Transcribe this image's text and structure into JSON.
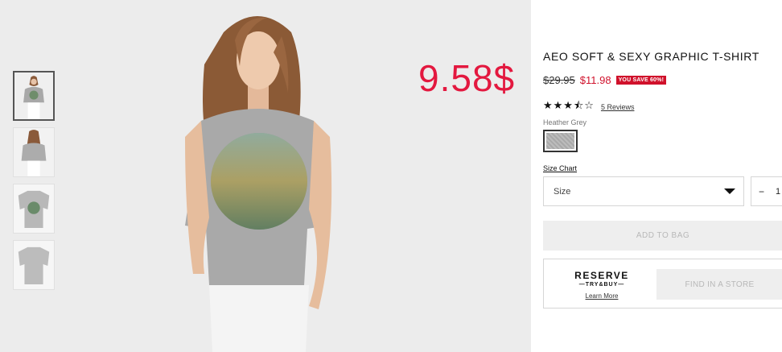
{
  "overlay_price": "9.58$",
  "product": {
    "title": "AEO SOFT & SEXY GRAPHIC T-SHIRT",
    "old_price": "$29.95",
    "sale_price": "$11.98",
    "save_badge": "YOU SAVE 60%!",
    "stars_display": "★★★⯪☆",
    "rating": 3.5,
    "rating_max": 5,
    "reviews_link": "5 Reviews",
    "color_name": "Heather Grey",
    "size_chart_link": "Size Chart",
    "size_select_label": "Size",
    "qty_minus": "−",
    "qty_value": "1",
    "add_to_bag": "ADD TO BAG"
  },
  "reserve": {
    "title": "RESERVE",
    "subtitle": "—TRY&BUY—",
    "learn_more": "Learn More",
    "find_store": "FIND IN A STORE"
  },
  "colors": {
    "sale_red": "#d0112b",
    "overlay_red": "#e3183f",
    "disabled_bg": "#eeeeee",
    "disabled_text": "#b8b8b8",
    "shirt_grey": "#a9a9a9"
  },
  "icons": {
    "dropdown": "chevron-down-icon",
    "stars": "star-icon"
  }
}
